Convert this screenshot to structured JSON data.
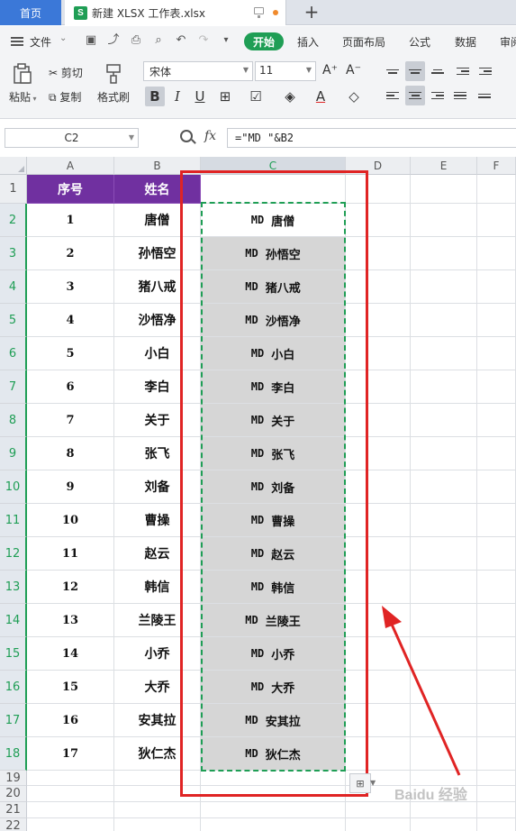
{
  "tabs": {
    "home_label": "首页",
    "file_label": "新建 XLSX 工作表.xlsx",
    "file_icon_letter": "S"
  },
  "menu": {
    "file_label": "文件",
    "start_label": "开始",
    "items": [
      "插入",
      "页面布局",
      "公式",
      "数据",
      "审阅"
    ]
  },
  "ribbon": {
    "paste_label": "粘贴",
    "cut_label": "剪切",
    "copy_label": "复制",
    "format_painter_label": "格式刷",
    "font_name": "宋体",
    "font_size": "11",
    "bold_label": "B",
    "italic_label": "I",
    "underline_label": "U",
    "grow_font_label": "A⁺",
    "shrink_font_label": "A⁻"
  },
  "formula_bar": {
    "cell_ref": "C2",
    "fx_label": "fx",
    "formula": "=\"MD \"&B2"
  },
  "columns": [
    "A",
    "B",
    "C",
    "D",
    "E",
    "F"
  ],
  "rows": [
    "1",
    "2",
    "3",
    "4",
    "5",
    "6",
    "7",
    "8",
    "9",
    "10",
    "11",
    "12",
    "13",
    "14",
    "15",
    "16",
    "17",
    "18",
    "19",
    "20",
    "21",
    "22"
  ],
  "table": {
    "headers": [
      "序号",
      "姓名"
    ],
    "records": [
      {
        "no": "1",
        "name": "唐僧",
        "prefix": "MD",
        "result": "唐僧"
      },
      {
        "no": "2",
        "name": "孙悟空",
        "prefix": "MD",
        "result": "孙悟空"
      },
      {
        "no": "3",
        "name": "猪八戒",
        "prefix": "MD",
        "result": "猪八戒"
      },
      {
        "no": "4",
        "name": "沙悟净",
        "prefix": "MD",
        "result": "沙悟净"
      },
      {
        "no": "5",
        "name": "小白",
        "prefix": "MD",
        "result": "小白"
      },
      {
        "no": "6",
        "name": "李白",
        "prefix": "MD",
        "result": "李白"
      },
      {
        "no": "7",
        "name": "关于",
        "prefix": "MD",
        "result": "关于"
      },
      {
        "no": "8",
        "name": "张飞",
        "prefix": "MD",
        "result": "张飞"
      },
      {
        "no": "9",
        "name": "刘备",
        "prefix": "MD",
        "result": "刘备"
      },
      {
        "no": "10",
        "name": "曹操",
        "prefix": "MD",
        "result": "曹操"
      },
      {
        "no": "11",
        "name": "赵云",
        "prefix": "MD",
        "result": "赵云"
      },
      {
        "no": "12",
        "name": "韩信",
        "prefix": "MD",
        "result": "韩信"
      },
      {
        "no": "13",
        "name": "兰陵王",
        "prefix": "MD",
        "result": "兰陵王"
      },
      {
        "no": "14",
        "name": "小乔",
        "prefix": "MD",
        "result": "小乔"
      },
      {
        "no": "15",
        "name": "大乔",
        "prefix": "MD",
        "result": "大乔"
      },
      {
        "no": "16",
        "name": "安其拉",
        "prefix": "MD",
        "result": "安其拉"
      },
      {
        "no": "17",
        "name": "狄仁杰",
        "prefix": "MD",
        "result": "狄仁杰"
      }
    ]
  },
  "colors": {
    "header_fill": "#7030a0",
    "accent_green": "#1f9e55",
    "annotation_red": "#e02424",
    "result_fill": "#d6d6d6"
  },
  "watermark": "Baidu 经验"
}
